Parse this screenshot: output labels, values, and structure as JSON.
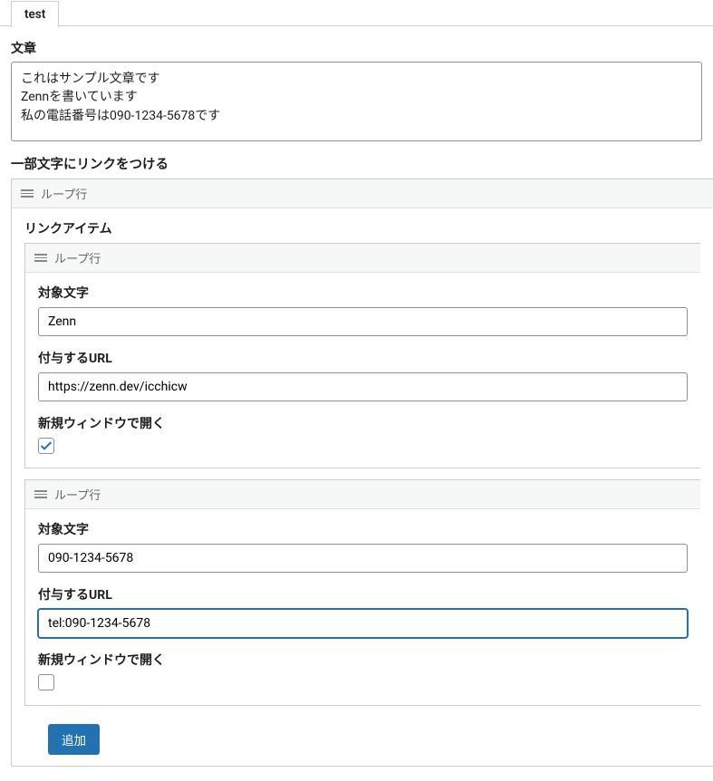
{
  "tab": {
    "label": "test"
  },
  "text_field": {
    "label": "文章",
    "value": "これはサンプル文章です\nZennを書いています\n私の電話番号は090-1234-5678です"
  },
  "link_section": {
    "heading": "一部文字にリンクをつける",
    "loop_label": "ループ行",
    "link_item_label": "リンクアイテム",
    "target_label": "対象文字",
    "url_label": "付与するURL",
    "new_window_label": "新規ウィンドウで開く",
    "items": [
      {
        "target": "Zenn",
        "url": "https://zenn.dev/icchicw",
        "new_window": true
      },
      {
        "target": "090-1234-5678",
        "url": "tel:090-1234-5678",
        "new_window": false
      }
    ],
    "add_button": "追加"
  }
}
